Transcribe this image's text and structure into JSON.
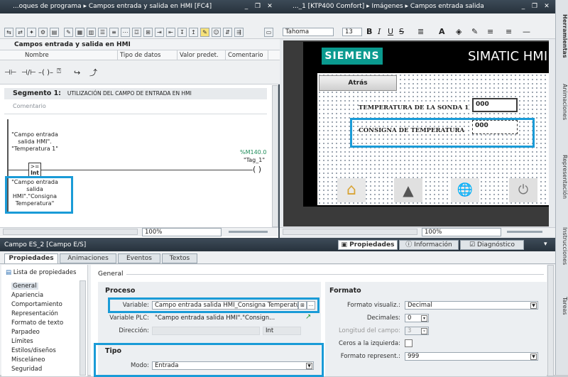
{
  "left_window": {
    "title": "...oques de programa ▸ Campos entrada y salida en HMI [FC4]",
    "block_title": "Campos entrada y salida en HMI",
    "columns": [
      "Nombre",
      "Tipo de datos",
      "Valor predet.",
      "Comentario"
    ],
    "segment_label": "Segmento 1:",
    "segment_title": "UTILIZACIÓN DEL CAMPO DE ENTRADA EN HMI",
    "comment_placeholder": "Comentario",
    "operand1": "\"Campo entrada salida HMI\". \"Temperatura 1\"",
    "compare_op": ">=",
    "compare_type": "Int",
    "operand2": "\"Campo entrada salida HMI\".\"Consigna Temperatura\"",
    "coil_address": "%M140.0",
    "coil_tag": "\"Tag_1\"",
    "zoom": "100%"
  },
  "right_window": {
    "title": "..._1 [KTP400 Comfort] ▸ Imágenes ▸ Campos entrada salida",
    "font": "Tahoma",
    "font_size": "13",
    "brand": "SIEMENS",
    "product": "SIMATIC HMI",
    "back_button": "Atrás",
    "label1": "TEMPERATURA DE LA SONDA 1",
    "value1": "000",
    "label2": "CONSIGNA DE TEMPERATURA",
    "value2": "000",
    "zoom": "100%"
  },
  "side_tabs": [
    "Herramientas",
    "Animaciones",
    "Representación",
    "Instrucciones",
    "Tareas"
  ],
  "inspector": {
    "title": "Campo ES_2 [Campo E/S]",
    "right_tabs": [
      "Propiedades",
      "Información",
      "Diagnóstico"
    ],
    "tabs": [
      "Propiedades",
      "Animaciones",
      "Eventos",
      "Textos"
    ],
    "list_link": "Lista de propiedades",
    "nav": [
      "General",
      "Apariencia",
      "Comportamiento",
      "Representación",
      "Formato de texto",
      "Parpadeo",
      "Límites",
      "Estilos/diseños",
      "Misceláneo",
      "Seguridad"
    ],
    "section_header": "General",
    "proceso": {
      "title": "Proceso",
      "variable_label": "Variable:",
      "variable_value": "Campo entrada salida HMI_Consigna Temperatura",
      "plc_label": "Variable PLC:",
      "plc_value": "\"Campo entrada salida HMI\".\"Consign...",
      "direccion_label": "Dirección:",
      "direccion_value": "Int"
    },
    "tipo": {
      "title": "Tipo",
      "modo_label": "Modo:",
      "modo_value": "Entrada"
    },
    "formato": {
      "title": "Formato",
      "visual_label": "Formato visualiz.:",
      "visual_value": "Decimal",
      "decimales_label": "Decimales:",
      "decimales_value": "0",
      "longitud_label": "Longitud del campo:",
      "longitud_value": "3",
      "ceros_label": "Ceros a la izquierda:",
      "repr_label": "Formato represent.:",
      "repr_value": "999"
    }
  },
  "colors": {
    "highlight": "#1a9bd7",
    "siemens": "#0a9a8f",
    "titlebar": "#2f3b46"
  }
}
